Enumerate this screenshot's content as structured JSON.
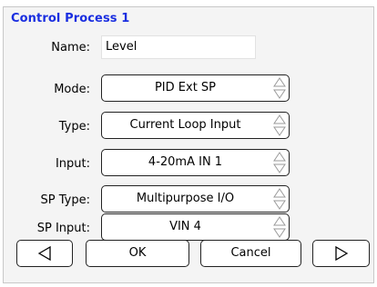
{
  "dialog": {
    "title": "Control Process 1"
  },
  "fields": {
    "name": {
      "label": "Name:",
      "value": "Level"
    },
    "mode": {
      "label": "Mode:",
      "value": "PID Ext SP"
    },
    "type": {
      "label": "Type:",
      "value": "Current Loop Input"
    },
    "input": {
      "label": "Input:",
      "value": "4-20mA IN 1"
    },
    "sp_type": {
      "label": "SP Type:",
      "value": "Multipurpose I/O"
    },
    "sp_input": {
      "label": "SP Input:",
      "value": "VIN 4"
    }
  },
  "buttons": {
    "prev_icon": "triangle-left-icon",
    "ok": "OK",
    "cancel": "Cancel",
    "next_icon": "triangle-right-icon"
  },
  "colors": {
    "title": "#1a2ee0",
    "spinner": "#9a9a9a"
  }
}
